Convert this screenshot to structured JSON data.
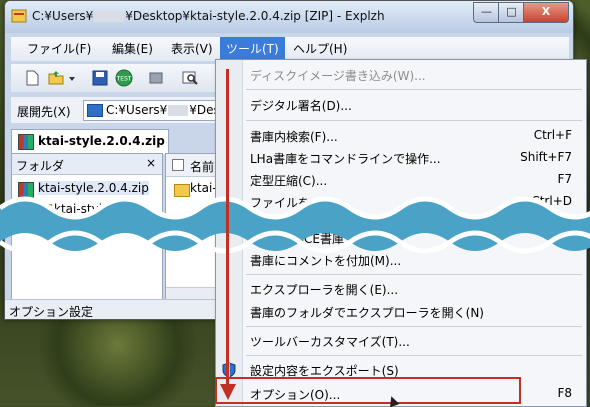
{
  "window": {
    "title_prefix": "C:¥Users¥",
    "title_suffix": "¥Desktop¥ktai-style.2.0.4.zip [ZIP] - Explzh",
    "buttons": {
      "minimize": "—",
      "maximize": "□",
      "close": "X"
    }
  },
  "menubar": {
    "items": [
      {
        "label": "ファイル(F)"
      },
      {
        "label": "編集(E)"
      },
      {
        "label": "表示(V)"
      },
      {
        "label": "ツール(T)",
        "active": true
      },
      {
        "label": "ヘルプ(H)"
      }
    ]
  },
  "toolbar": {
    "icons": [
      "new-icon",
      "open-icon",
      "dropdown-arrow-icon",
      "save-icon",
      "test-icon",
      "extract-icon",
      "search-icon"
    ],
    "test_label": "TEST"
  },
  "address": {
    "label": "展開先(X)",
    "value_prefix": "C:¥Users¥",
    "value_suffix": "¥Desk"
  },
  "doc_tab": {
    "label": "ktai-style.2.0.4.zip"
  },
  "tree": {
    "header": "フォルダ",
    "close": "×",
    "items": [
      "ktai-style.2.0.4.zip",
      "ktai-style"
    ]
  },
  "filelist": {
    "column_name": "名前",
    "rows": [
      "ktai-s"
    ]
  },
  "status": {
    "text": "オプション設定"
  },
  "tools_menu": {
    "items": [
      {
        "label": "ディスクイメージ書き込み(W)...",
        "shortcut": "",
        "disabled": true
      },
      {
        "label": "デジタル署名(D)...",
        "shortcut": ""
      },
      {
        "label": "書庫内検索(F)...",
        "shortcut": "Ctrl+F"
      },
      {
        "label": "LHa書庫をコマンドラインで操作...",
        "shortcut": "Shift+F7"
      },
      {
        "label": "定型圧縮(C)...",
        "shortcut": "F7"
      },
      {
        "label": "ファイルを",
        "shortcut": "Ctrl+D"
      },
      {
        "label": "ACE書庫",
        "shortcut": ""
      },
      {
        "label": "書庫にコメントを付加(M)...",
        "shortcut": ""
      },
      {
        "label": "エクスプローラを開く(E)...",
        "shortcut": ""
      },
      {
        "label": "書庫のフォルダでエクスプローラを開く(N)",
        "shortcut": ""
      },
      {
        "label": "ツールバーカスタマイズ(T)...",
        "shortcut": ""
      },
      {
        "label": "設定内容をエクスポート(S)",
        "shortcut": ""
      },
      {
        "label": "オプション(O)...",
        "shortcut": "F8"
      }
    ]
  },
  "colors": {
    "highlight": "#c22f24",
    "wave": "#4aa3c6",
    "menu_active": "#3b7bd9"
  }
}
